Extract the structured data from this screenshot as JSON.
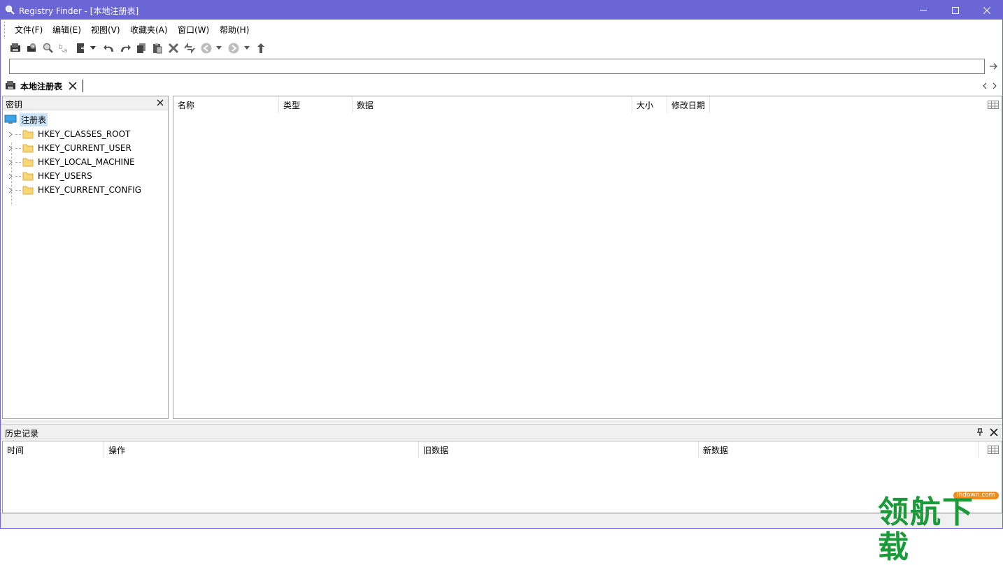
{
  "window": {
    "title": "Registry Finder - [本地注册表]",
    "accent_color": "#6b66d6"
  },
  "menu": {
    "items": [
      "文件(F)",
      "编辑(E)",
      "视图(V)",
      "收藏夹(A)",
      "窗口(W)",
      "帮助(H)"
    ]
  },
  "toolbar": {
    "icons": [
      "local-registry-icon",
      "remote-registry-icon",
      "find-icon",
      "replace-icon",
      "export-icon",
      "dropdown-arrow-icon",
      "undo-icon",
      "redo-icon",
      "copy-icon",
      "paste-icon",
      "delete-icon",
      "refresh-icon",
      "back-icon",
      "dropdown-arrow-icon",
      "forward-icon",
      "dropdown-arrow-icon",
      "up-level-icon"
    ]
  },
  "address": {
    "value": ""
  },
  "doc_tab": {
    "label": "本地注册表"
  },
  "key_pane": {
    "title": "密钥",
    "root_label": "注册表",
    "nodes": [
      "HKEY_CLASSES_ROOT",
      "HKEY_CURRENT_USER",
      "HKEY_LOCAL_MACHINE",
      "HKEY_USERS",
      "HKEY_CURRENT_CONFIG"
    ]
  },
  "value_pane": {
    "columns": [
      "名称",
      "类型",
      "数据",
      "大小",
      "修改日期"
    ]
  },
  "history_pane": {
    "title": "历史记录",
    "columns": [
      "时间",
      "操作",
      "旧数据",
      "新数据"
    ]
  },
  "watermark": {
    "url": "lhdown.com",
    "text": "领航下载"
  }
}
